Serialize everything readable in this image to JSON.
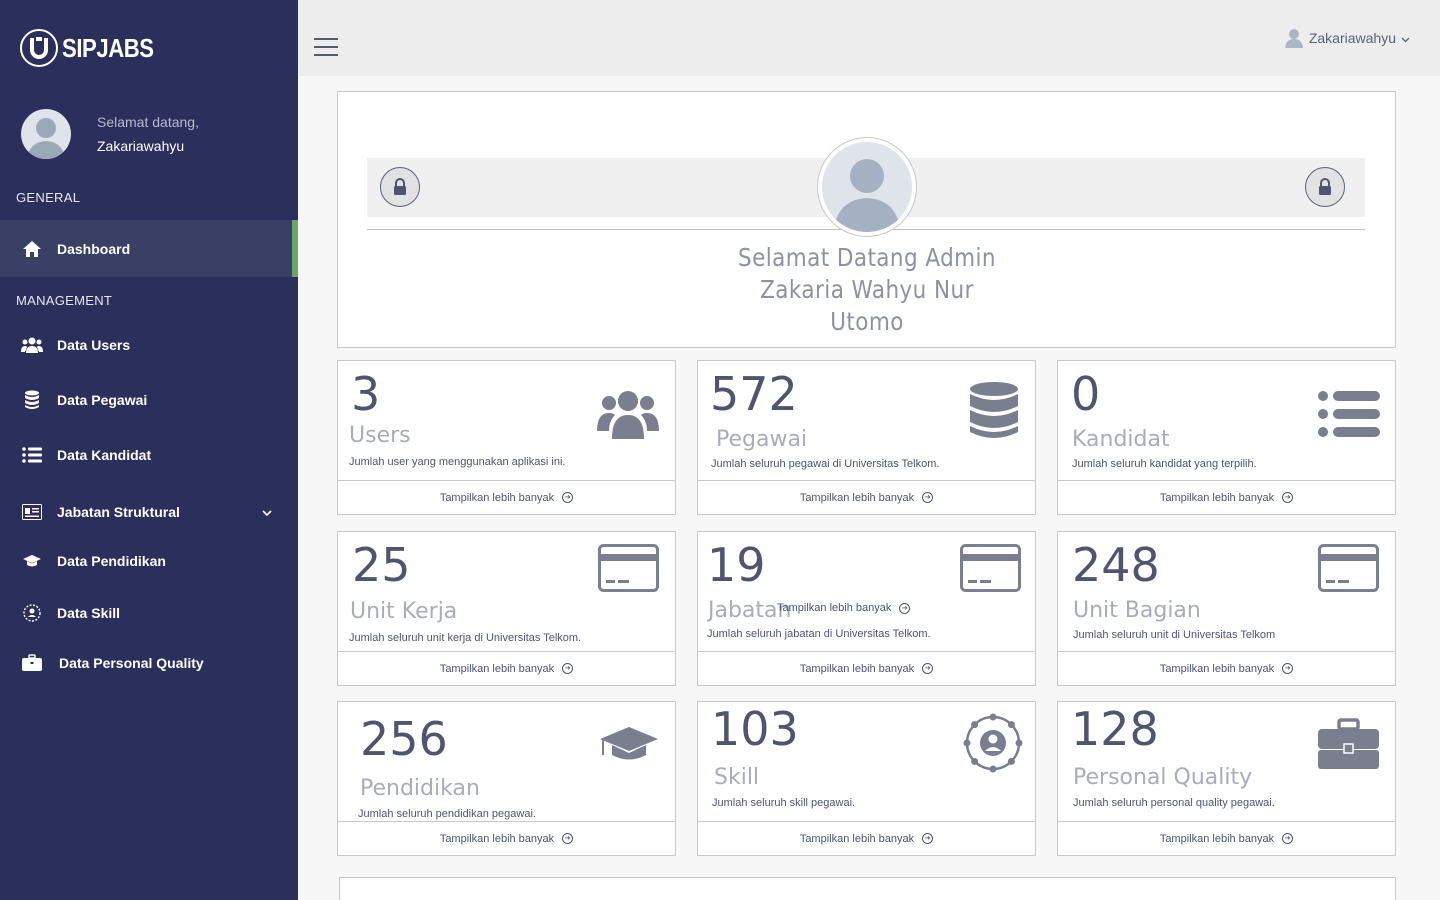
{
  "brand": {
    "name": "SIPJABS",
    "logo_letter": "U"
  },
  "profile": {
    "greeting_label": "Selamat datang,",
    "username": "Zakariawahyu"
  },
  "sidebar": {
    "section_general": "GENERAL",
    "section_management": "MANAGEMENT",
    "items": [
      {
        "label": "Dashboard",
        "icon": "home-icon"
      },
      {
        "label": "Data Users",
        "icon": "users-icon"
      },
      {
        "label": "Data Pegawai",
        "icon": "database-icon"
      },
      {
        "label": "Data Kandidat",
        "icon": "list-icon"
      },
      {
        "label": "Jabatan Struktural",
        "icon": "id-card-icon"
      },
      {
        "label": "Data Pendidikan",
        "icon": "graduation-cap-icon"
      },
      {
        "label": "Data Skill",
        "icon": "skill-icon"
      },
      {
        "label": "Data Personal Quality",
        "icon": "briefcase-icon"
      }
    ]
  },
  "topbar": {
    "user": "Zakariawahyu"
  },
  "welcome": {
    "line1": "Selamat Datang Admin",
    "line2": "Zakaria Wahyu Nur",
    "line3": "Utomo"
  },
  "stats": [
    {
      "value": "3",
      "title": "Users",
      "desc": "Jumlah user yang menggunakan aplikasi ini.",
      "link": "Tampilkan lebih banyak",
      "icon": "users-icon"
    },
    {
      "value": "572",
      "title": "Pegawai",
      "desc": "Jumlah seluruh pegawai di Universitas Telkom.",
      "link": "Tampilkan lebih banyak",
      "icon": "database-icon"
    },
    {
      "value": "0",
      "title": "Kandidat",
      "desc": "Jumlah seluruh kandidat yang terpilih.",
      "link": "Tampilkan lebih banyak",
      "icon": "list-icon"
    },
    {
      "value": "25",
      "title": "Unit Kerja",
      "desc": "Jumlah seluruh unit kerja di Universitas Telkom.",
      "link": "Tampilkan lebih banyak",
      "icon": "credit-card-icon"
    },
    {
      "value": "19",
      "title": "Jabatan",
      "desc": "Jumlah seluruh jabatan di Universitas Telkom.",
      "link": "Tampilkan lebih banyak",
      "link_overlap": "Tampilkan lebih banyak",
      "icon": "credit-card-icon"
    },
    {
      "value": "248",
      "title": "Unit Bagian",
      "desc": "Jumlah seluruh unit di Universitas Telkom",
      "link": "Tampilkan lebih banyak",
      "icon": "credit-card-icon"
    },
    {
      "value": "256",
      "title": "Pendidikan",
      "desc": "Jumlah seluruh pendidikan pegawai.",
      "link": "Tampilkan lebih banyak",
      "icon": "graduation-cap-icon"
    },
    {
      "value": "103",
      "title": "Skill",
      "desc": "Jumlah seluruh skill pegawai.",
      "link": "Tampilkan lebih banyak",
      "icon": "skill-icon"
    },
    {
      "value": "128",
      "title": "Personal Quality",
      "desc": "Jumlah seluruh personal quality pegawai.",
      "link": "Tampilkan lebih banyak",
      "icon": "briefcase-icon"
    }
  ],
  "colors": {
    "sidebar": "#2a2f5b",
    "active_accent": "#6fa563",
    "text_dark": "#4f5470",
    "icon_grey": "#7a7e8f"
  }
}
